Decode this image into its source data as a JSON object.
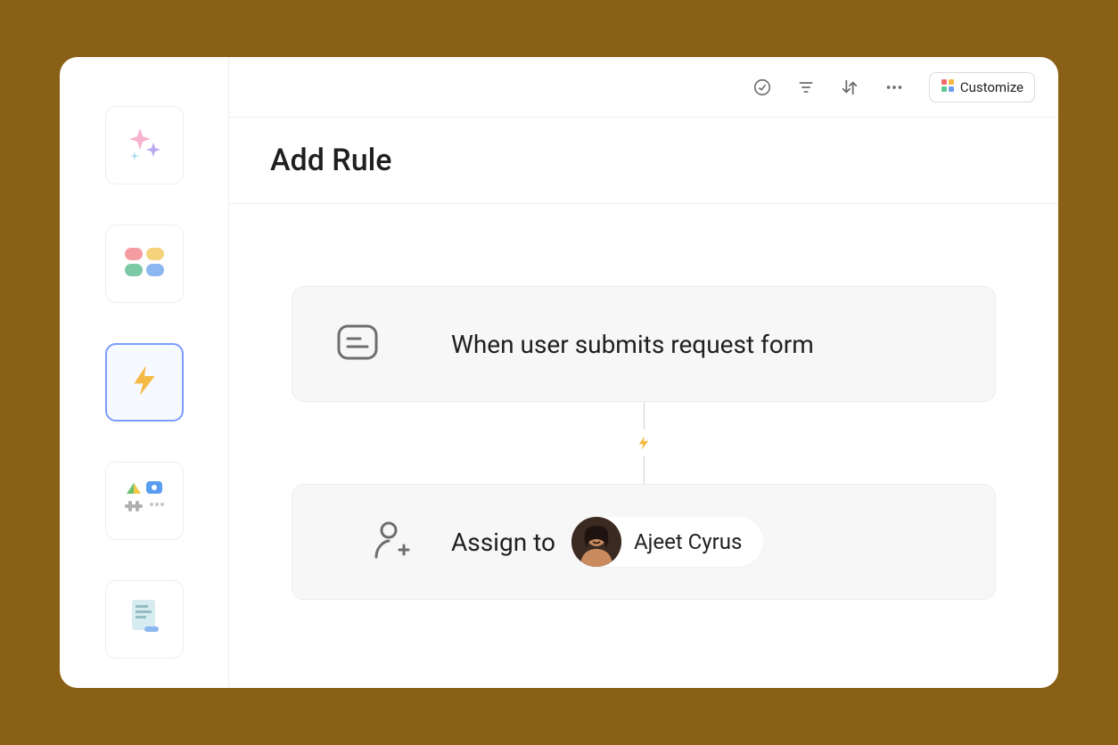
{
  "toolbar": {
    "customize_label": "Customize"
  },
  "header": {
    "title": "Add Rule"
  },
  "rule": {
    "trigger_text": "When user submits request form",
    "action_label": "Assign to",
    "assignee_name": "Ajeet Cyrus"
  },
  "sidebar": {
    "items": [
      {
        "name": "ai-sparkle"
      },
      {
        "name": "color-blocks"
      },
      {
        "name": "automation-bolt",
        "active": true
      },
      {
        "name": "integrations"
      },
      {
        "name": "document"
      }
    ]
  },
  "colors": {
    "accent_yellow": "#f5b945",
    "brand_blue": "#7b9cff"
  }
}
